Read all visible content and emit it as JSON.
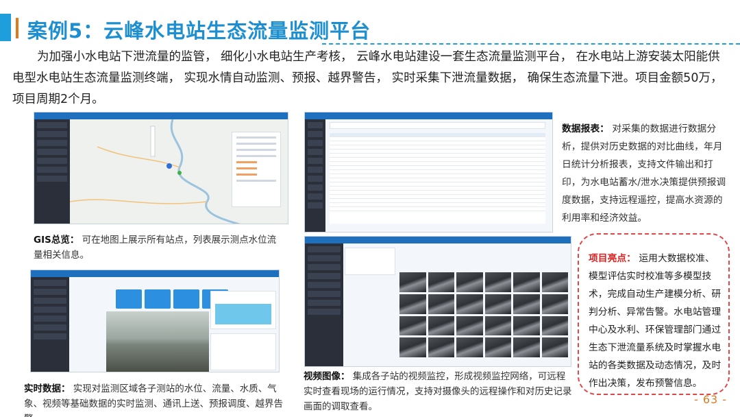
{
  "title": "案例5：云峰水电站生态流量监测平台",
  "intro": "为加强小水电站下泄流量的监管， 细化小水电站生产考核， 云峰水电站建设一套生态流量监测平台， 在水电站上游安装太阳能供电型水电站生态流量监测终端， 实现水情自动监测、预报、越界警告， 实时采集下泄流量数据， 确保生态流量下泄。项目金额50万， 项目周期2个月。",
  "sections": {
    "gis": {
      "label": "GIS总览：",
      "text": " 可在地图上展示所有站点，列表展示测点水位流量相关信息。"
    },
    "report": {
      "label": "数据报表：",
      "text": " 对采集的数据进行数据分析，提供对历史数据的对比曲线，年月日统计分析报表，支持文件输出和打印，为水电站蓄水/泄水决策提供预报调度数据，支持远程遥控，提高水资源的利用率和经济效益。"
    },
    "live": {
      "label": "实时数据：",
      "text": " 实现对监测区域各子测站的水位、流量、水质、气象、视频等基础数据的实时监测、通讯上送、预报调度、越界告警。"
    },
    "video": {
      "label": "视频图像：",
      "text": " 集成各子站的视频监控，形成视频监控网络，可远程实时查看现场的运行情况，支持对摄像头的远程操作和对历史记录画面的调取查看。"
    },
    "highlight": {
      "label": "项目亮点：",
      "text": " 运用大数据校准、模型评估实时校准等多模型技术，完成自动生产建模分析、研判分析、异常告警。水电站管理中心及水利、环保管理部门通过生态下泄流量系统及时掌握水电站的各类数据及动态情况，及时作出决策，发布预警信息。"
    }
  },
  "page_number": "- 63 -",
  "colors": {
    "title": "#1d8fd0",
    "accent_blue": "#1e9fdc",
    "accent_orange": "#e07a1f",
    "highlight_red": "#e02020"
  }
}
